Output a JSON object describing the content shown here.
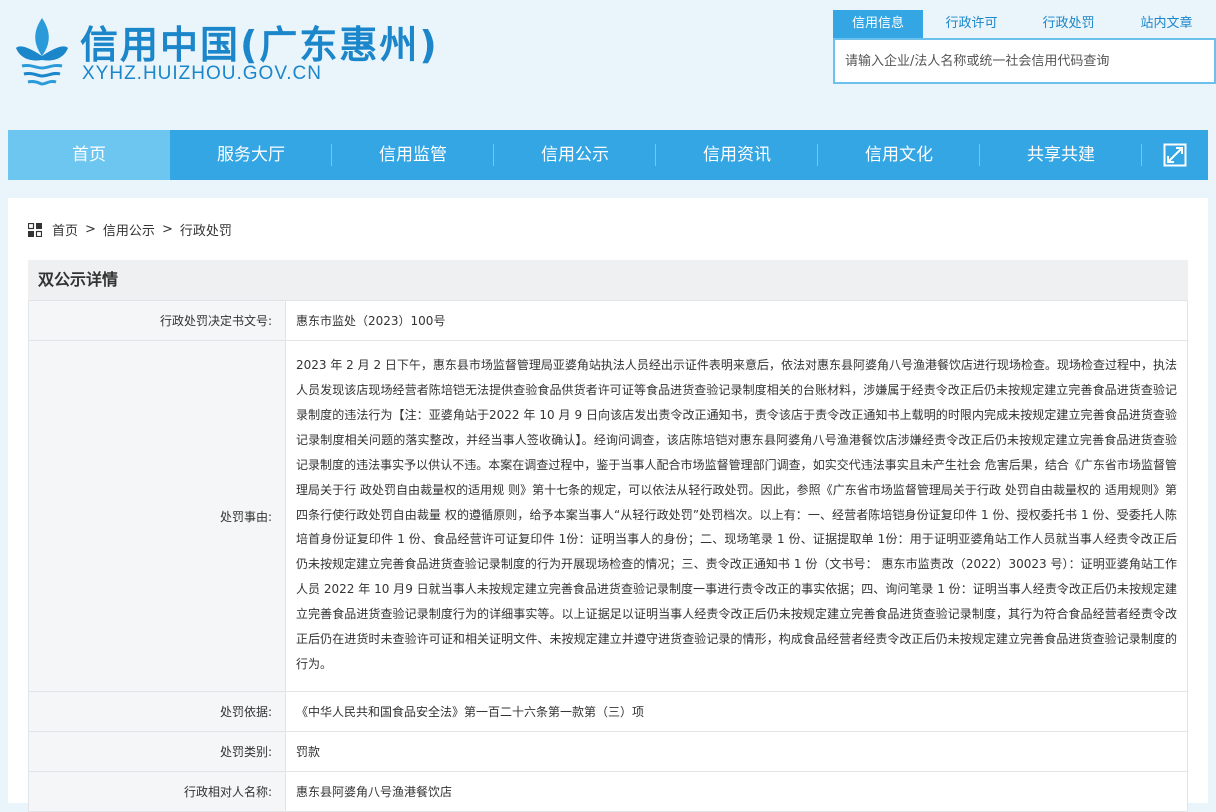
{
  "header": {
    "site_title": "信用中国(广东惠州)",
    "site_domain": "XYHZ.HUIZHOU.GOV.CN",
    "brand_color": "#1b86c9",
    "logo_icon": "lotus-flower-logo-icon"
  },
  "search": {
    "tabs": [
      {
        "label": "信用信息",
        "active": true
      },
      {
        "label": "行政许可",
        "active": false
      },
      {
        "label": "行政处罚",
        "active": false
      },
      {
        "label": "站内文章",
        "active": false
      }
    ],
    "placeholder": "请输入企业/法人名称或统一社会信用代码查询",
    "accent_color": "#33a6e3"
  },
  "nav": {
    "items": [
      {
        "label": "首页",
        "active": true
      },
      {
        "label": "服务大厅",
        "active": false
      },
      {
        "label": "信用监管",
        "active": false
      },
      {
        "label": "信用公示",
        "active": false
      },
      {
        "label": "信用资讯",
        "active": false
      },
      {
        "label": "信用文化",
        "active": false
      },
      {
        "label": "共享共建",
        "active": false
      }
    ],
    "expand_icon": "expand-arrows-icon",
    "background_color": "#33a6e3",
    "active_color": "#6cc6f0"
  },
  "breadcrumb": {
    "icon": "grid-icon",
    "items": [
      "首页",
      "信用公示",
      "行政处罚"
    ],
    "separator": ">"
  },
  "section": {
    "title": "双公示详情"
  },
  "detail_rows": [
    {
      "label": "行政处罚决定书文号:",
      "value": "惠东市监处（2023）100号"
    },
    {
      "label": "处罚事由:",
      "value": "2023 年 2 月 2 日下午，惠东县市场监督管理局亚婆角站执法人员经出示证件表明来意后，依法对惠东县阿婆角八号渔港餐饮店进行现场检查。现场检查过程中，执法人员发现该店现场经营者陈培铠无法提供查验食品供货者许可证等食品进货查验记录制度相关的台账材料，涉嫌属于经责令改正后仍未按规定建立完善食品进货查验记录制度的违法行为【注：亚婆角站于2022 年 10 月 9 日向该店发出责令改正通知书，责令该店于责令改正通知书上载明的时限内完成未按规定建立完善食品进货查验记录制度相关问题的落实整改，并经当事人签收确认】。经询问调查，该店陈培铠对惠东县阿婆角八号渔港餐饮店涉嫌经责令改正后仍未按规定建立完善食品进货查验记录制度的违法事实予以供认不违。本案在调查过程中，鉴于当事人配合市场监督管理部门调查，如实交代违法事实且未产生社会 危害后果，结合《广东省市场监督管理局关于行 政处罚自由裁量权的适用规 则》第十七条的规定，可以依法从轻行政处罚。因此，参照《广东省市场监督管理局关于行政 处罚自由裁量权的 适用规则》第四条行使行政处罚自由裁量 权的遵循原则，给予本案当事人“从轻行政处罚”处罚档次。以上有：一、经营者陈培铠身份证复印件 1 份、授权委托书 1 份、受委托人陈培首身份证复印件 1 份、食品经营许可证复印件 1份：证明当事人的身份；二、现场笔录 1 份、证据提取单 1份：用于证明亚婆角站工作人员就当事人经责令改正后仍未按规定建立完善食品进货查验记录制度的行为开展现场检查的情况；三、责令改正通知书 1 份（文书号： 惠东市监责改（2022）30023 号）：证明亚婆角站工作人员 2022 年 10 月9 日就当事人未按规定建立完善食品进货查验记录制度一事进行责令改正的事实依据；四、询问笔录 1 份：证明当事人经责令改正后仍未按规定建立完善食品进货查验记录制度行为的详细事实等。以上证据足以证明当事人经责令改正后仍未按规定建立完善食品进货查验记录制度，其行为符合食品经营者经责令改正后仍在进货时未查验许可证和相关证明文件、未按规定建立并遵守进货查验记录的情形，构成食品经营者经责令改正后仍未按规定建立完善食品进货查验记录制度的行为。"
    },
    {
      "label": "处罚依据:",
      "value": "《中华人民共和国食品安全法》第一百二十六条第一款第（三）项"
    },
    {
      "label": "处罚类别:",
      "value": "罚款"
    },
    {
      "label": "行政相对人名称:",
      "value": "惠东县阿婆角八号渔港餐饮店"
    }
  ]
}
